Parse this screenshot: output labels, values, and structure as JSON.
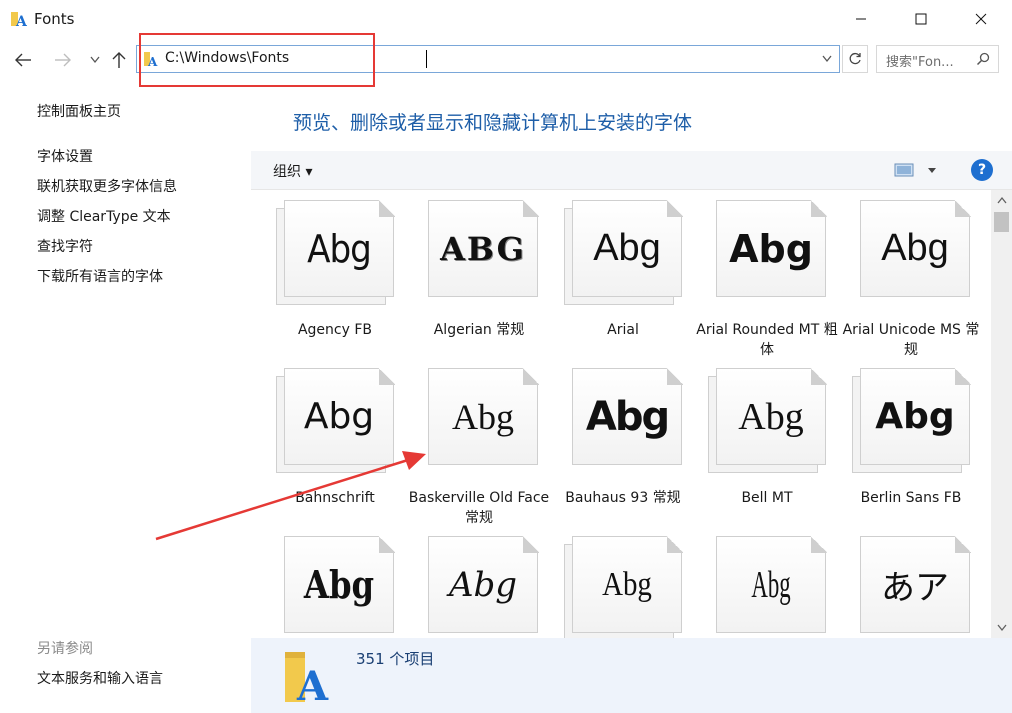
{
  "window": {
    "title": "Fonts",
    "controls": {
      "minimize": "minimize-icon",
      "maximize": "maximize-icon",
      "close": "close-icon"
    }
  },
  "nav": {
    "address": "C:\\Windows\\Fonts",
    "search_placeholder": "搜索\"Fon...",
    "icons": [
      "back-arrow-icon",
      "forward-arrow-icon",
      "chevron-down-icon",
      "up-arrow-icon",
      "refresh-icon",
      "search-icon"
    ]
  },
  "sidebar": {
    "home": "控制面板主页",
    "links": [
      "字体设置",
      "联机获取更多字体信息",
      "调整 ClearType 文本",
      "查找字符",
      "下载所有语言的字体"
    ],
    "see_also_title": "另请参阅",
    "see_also_links": [
      "文本服务和输入语言"
    ]
  },
  "main": {
    "heading": "预览、删除或者显示和隐藏计算机上安装的字体",
    "toolbar": {
      "organize": "组织 ▾",
      "help": "?"
    },
    "fonts": [
      {
        "name": "Agency FB",
        "sample": "Abg",
        "stacked": true
      },
      {
        "name": "Algerian 常规",
        "sample": "ABG",
        "stacked": false
      },
      {
        "name": "Arial",
        "sample": "Abg",
        "stacked": true
      },
      {
        "name": "Arial Rounded MT 粗体",
        "sample": "Abg",
        "stacked": false
      },
      {
        "name": "Arial Unicode MS 常规",
        "sample": "Abg",
        "stacked": false
      },
      {
        "name": "Bahnschrift",
        "sample": "Abg",
        "stacked": true
      },
      {
        "name": "Baskerville Old Face 常规",
        "sample": "Abg",
        "stacked": false
      },
      {
        "name": "Bauhaus 93 常规",
        "sample": "Abg",
        "stacked": false
      },
      {
        "name": "Bell MT",
        "sample": "Abg",
        "stacked": true
      },
      {
        "name": "Berlin Sans FB",
        "sample": "Abg",
        "stacked": true
      },
      {
        "name": "",
        "sample": "Abg",
        "stacked": false
      },
      {
        "name": "",
        "sample": "Abg",
        "stacked": false
      },
      {
        "name": "",
        "sample": "Abg",
        "stacked": true
      },
      {
        "name": "",
        "sample": "Abg",
        "stacked": false
      },
      {
        "name": "",
        "sample": "あア",
        "stacked": false
      }
    ]
  },
  "details": {
    "count": "351 个项目"
  },
  "annotations": {
    "highlight_color": "#e53935",
    "arrow_color": "#e53935"
  }
}
